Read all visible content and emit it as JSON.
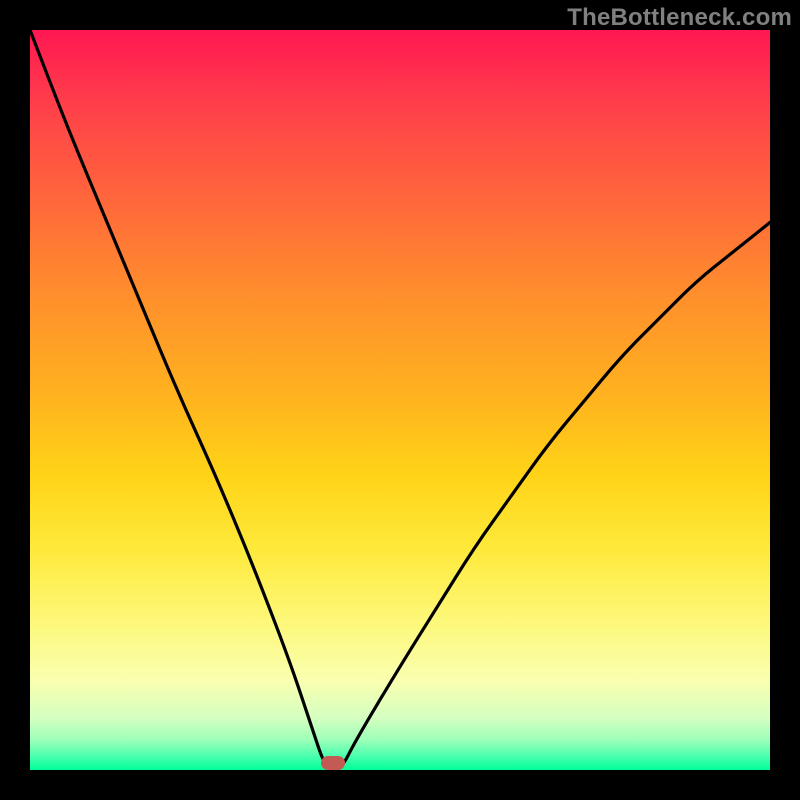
{
  "watermark": "TheBottleneck.com",
  "colors": {
    "frame": "#000000",
    "gradient_top": "#ff1752",
    "gradient_bottom": "#00ff99",
    "curve": "#000000",
    "marker": "#c35a54",
    "watermark_text": "#808080"
  },
  "chart_data": {
    "type": "line",
    "title": "",
    "xlabel": "",
    "ylabel": "",
    "xlim": [
      0,
      100
    ],
    "ylim": [
      0,
      100
    ],
    "series": [
      {
        "name": "bottleneck-curve",
        "x": [
          0,
          5,
          10,
          15,
          20,
          25,
          30,
          35,
          38,
          40,
          42,
          44,
          50,
          55,
          60,
          65,
          70,
          75,
          80,
          85,
          90,
          95,
          100
        ],
        "y": [
          100,
          87,
          75,
          63,
          51,
          40,
          28,
          15,
          6,
          0,
          0,
          4,
          14,
          22,
          30,
          37,
          44,
          50,
          56,
          61,
          66,
          70,
          74
        ]
      }
    ],
    "annotations": [
      {
        "name": "optimal-marker",
        "x": 41,
        "y": 1
      }
    ]
  }
}
